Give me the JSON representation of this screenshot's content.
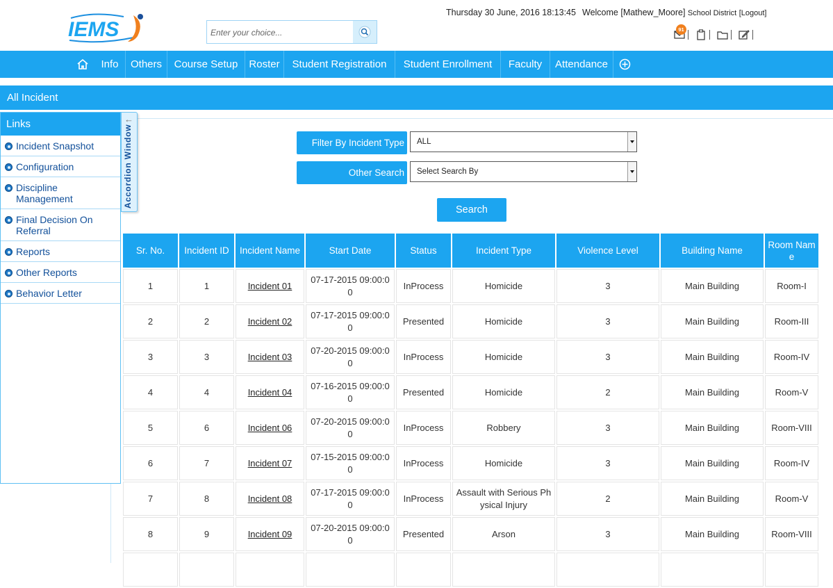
{
  "header": {
    "logo_text": "IEMS",
    "search_placeholder": "Enter your choice...",
    "datetime": "Thursday 30 June, 2016 18:13:45",
    "welcome_prefix": "Welcome [Mathew_Moore]",
    "district": "School District",
    "logout": "[Logout]",
    "mail_badge": "91"
  },
  "nav": {
    "items": [
      "Info",
      "Others",
      "Course Setup",
      "Roster",
      "Student Registration",
      "Student Enrollment",
      "Faculty",
      "Attendance"
    ]
  },
  "page_title": "All Incident",
  "sidebar": {
    "title": "Links",
    "items": [
      {
        "label": "Incident Snapshot"
      },
      {
        "label": "Configuration"
      },
      {
        "label": "Discipline Management"
      },
      {
        "label": "Final Decision On Referral"
      },
      {
        "label": "Reports"
      },
      {
        "label": "Other Reports"
      },
      {
        "label": "Behavior Letter"
      }
    ],
    "accordion_label": "Accordion Window"
  },
  "filters": {
    "incident_type_label": "Filter By Incident Type",
    "incident_type_value": "ALL",
    "other_search_label": "Other Search",
    "other_search_value": "Select Search By",
    "search_button": "Search"
  },
  "table": {
    "headers": [
      "Sr. No.",
      "Incident ID",
      "Incident Name",
      "Start Date",
      "Status",
      "Incident Type",
      "Violence Level",
      "Building Name",
      "Room Name"
    ],
    "rows": [
      [
        "1",
        "1",
        "Incident 01",
        "07-17-2015 09:00:00",
        "InProcess",
        "Homicide",
        "3",
        "Main Building",
        "Room-I"
      ],
      [
        "2",
        "2",
        "Incident 02",
        "07-17-2015 09:00:00",
        "Presented",
        "Homicide",
        "3",
        "Main Building",
        "Room-III"
      ],
      [
        "3",
        "3",
        "Incident 03",
        "07-20-2015 09:00:00",
        "InProcess",
        "Homicide",
        "3",
        "Main Building",
        "Room-IV"
      ],
      [
        "4",
        "4",
        "Incident 04",
        "07-16-2015 09:00:00",
        "Presented",
        "Homicide",
        "2",
        "Main Building",
        "Room-V"
      ],
      [
        "5",
        "6",
        "Incident 06",
        "07-20-2015 09:00:00",
        "InProcess",
        "Robbery",
        "3",
        "Main Building",
        "Room-VIII"
      ],
      [
        "6",
        "7",
        "Incident 07",
        "07-15-2015 09:00:00",
        "InProcess",
        "Homicide",
        "3",
        "Main Building",
        "Room-IV"
      ],
      [
        "7",
        "8",
        "Incident 08",
        "07-17-2015 09:00:00",
        "InProcess",
        "Assault with Serious Physical Injury",
        "2",
        "Main Building",
        "Room-V"
      ],
      [
        "8",
        "9",
        "Incident 09",
        "07-20-2015 09:00:00",
        "Presented",
        "Arson",
        "3",
        "Main Building",
        "Room-VIII"
      ],
      [
        "",
        "",
        "",
        "",
        "",
        "",
        "",
        "",
        ""
      ]
    ]
  }
}
